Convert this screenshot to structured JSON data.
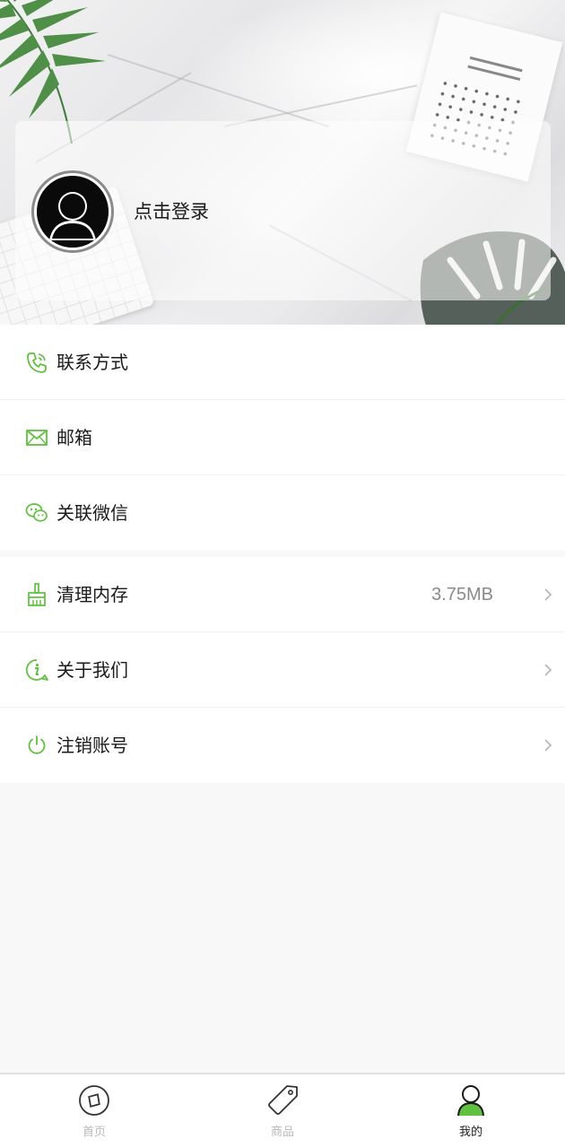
{
  "profile": {
    "login_text": "点击登录"
  },
  "menu_group_1": [
    {
      "label": "联系方式",
      "icon": "phone-icon"
    },
    {
      "label": "邮箱",
      "icon": "mail-icon"
    },
    {
      "label": "关联微信",
      "icon": "wechat-icon"
    }
  ],
  "menu_group_2": [
    {
      "label": "清理内存",
      "icon": "broom-icon",
      "value": "3.75MB"
    },
    {
      "label": "关于我们",
      "icon": "info-icon"
    },
    {
      "label": "注销账号",
      "icon": "power-icon"
    }
  ],
  "tabs": [
    {
      "label": "首页",
      "icon": "compass-icon",
      "active": false
    },
    {
      "label": "商品",
      "icon": "tag-icon",
      "active": false
    },
    {
      "label": "我的",
      "icon": "user-icon",
      "active": true
    }
  ],
  "colors": {
    "accent": "#5fc13f",
    "inactive": "#b8b8b8",
    "value_text": "#8a8a8a"
  }
}
